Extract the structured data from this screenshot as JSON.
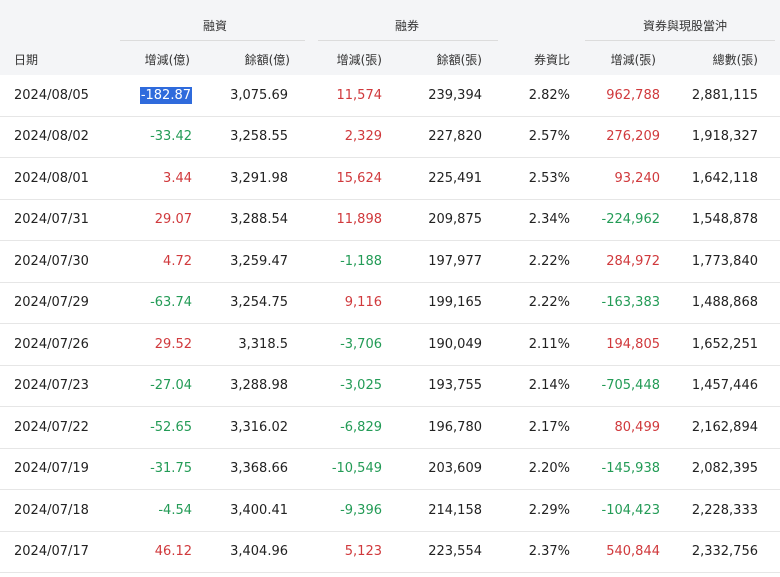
{
  "headers": {
    "groups": {
      "margin": "融資",
      "short": "融券",
      "daytrade": "資券與現股當沖"
    },
    "columns": {
      "date": "日期",
      "margin_change": "增減(億)",
      "margin_balance": "餘額(億)",
      "short_change": "增減(張)",
      "short_balance": "餘額(張)",
      "ratio": "券資比",
      "dt_change": "增減(張)",
      "dt_total": "總數(張)"
    }
  },
  "colors": {
    "up": "#d0393c",
    "down": "#239b56",
    "selection": "#2f6bdc"
  },
  "rows": [
    {
      "date": "2024/08/05",
      "margin_change": "-182.87",
      "margin_balance": "3,075.69",
      "short_change": "11,574",
      "short_balance": "239,394",
      "ratio": "2.82%",
      "dt_change": "962,788",
      "dt_total": "2,881,115"
    },
    {
      "date": "2024/08/02",
      "margin_change": "-33.42",
      "margin_balance": "3,258.55",
      "short_change": "2,329",
      "short_balance": "227,820",
      "ratio": "2.57%",
      "dt_change": "276,209",
      "dt_total": "1,918,327"
    },
    {
      "date": "2024/08/01",
      "margin_change": "3.44",
      "margin_balance": "3,291.98",
      "short_change": "15,624",
      "short_balance": "225,491",
      "ratio": "2.53%",
      "dt_change": "93,240",
      "dt_total": "1,642,118"
    },
    {
      "date": "2024/07/31",
      "margin_change": "29.07",
      "margin_balance": "3,288.54",
      "short_change": "11,898",
      "short_balance": "209,875",
      "ratio": "2.34%",
      "dt_change": "-224,962",
      "dt_total": "1,548,878"
    },
    {
      "date": "2024/07/30",
      "margin_change": "4.72",
      "margin_balance": "3,259.47",
      "short_change": "-1,188",
      "short_balance": "197,977",
      "ratio": "2.22%",
      "dt_change": "284,972",
      "dt_total": "1,773,840"
    },
    {
      "date": "2024/07/29",
      "margin_change": "-63.74",
      "margin_balance": "3,254.75",
      "short_change": "9,116",
      "short_balance": "199,165",
      "ratio": "2.22%",
      "dt_change": "-163,383",
      "dt_total": "1,488,868"
    },
    {
      "date": "2024/07/26",
      "margin_change": "29.52",
      "margin_balance": "3,318.5",
      "short_change": "-3,706",
      "short_balance": "190,049",
      "ratio": "2.11%",
      "dt_change": "194,805",
      "dt_total": "1,652,251"
    },
    {
      "date": "2024/07/23",
      "margin_change": "-27.04",
      "margin_balance": "3,288.98",
      "short_change": "-3,025",
      "short_balance": "193,755",
      "ratio": "2.14%",
      "dt_change": "-705,448",
      "dt_total": "1,457,446"
    },
    {
      "date": "2024/07/22",
      "margin_change": "-52.65",
      "margin_balance": "3,316.02",
      "short_change": "-6,829",
      "short_balance": "196,780",
      "ratio": "2.17%",
      "dt_change": "80,499",
      "dt_total": "2,162,894"
    },
    {
      "date": "2024/07/19",
      "margin_change": "-31.75",
      "margin_balance": "3,368.66",
      "short_change": "-10,549",
      "short_balance": "203,609",
      "ratio": "2.20%",
      "dt_change": "-145,938",
      "dt_total": "2,082,395"
    },
    {
      "date": "2024/07/18",
      "margin_change": "-4.54",
      "margin_balance": "3,400.41",
      "short_change": "-9,396",
      "short_balance": "214,158",
      "ratio": "2.29%",
      "dt_change": "-104,423",
      "dt_total": "2,228,333"
    },
    {
      "date": "2024/07/17",
      "margin_change": "46.12",
      "margin_balance": "3,404.96",
      "short_change": "5,123",
      "short_balance": "223,554",
      "ratio": "2.37%",
      "dt_change": "540,844",
      "dt_total": "2,332,756"
    }
  ]
}
